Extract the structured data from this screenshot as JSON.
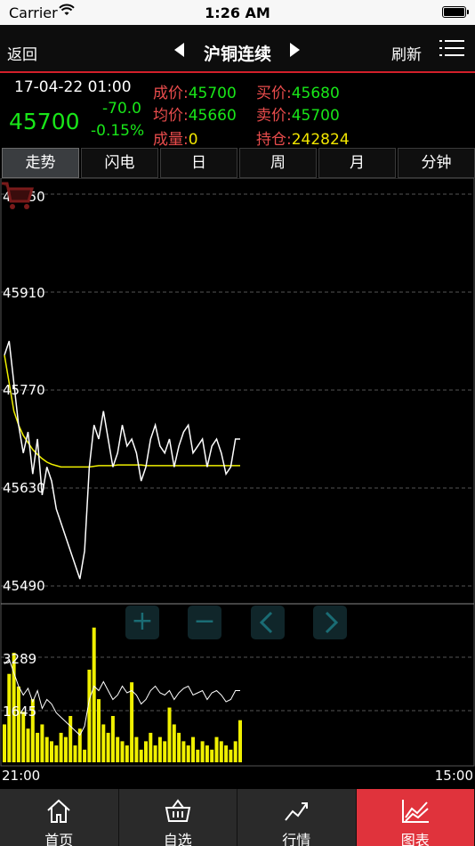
{
  "status": {
    "carrier": "Carrier",
    "time": "1:26 AM"
  },
  "nav": {
    "back": "返回",
    "title": "沪铜连续",
    "refresh": "刷新"
  },
  "quote": {
    "datetime": "17-04-22 01:00",
    "price": "45700",
    "change": "-70.0",
    "change_pct": "-0.15%",
    "fields": [
      {
        "label": "成价:",
        "value": "45700",
        "color": "green"
      },
      {
        "label": "均价:",
        "value": "45660",
        "color": "green"
      },
      {
        "label": "成量:",
        "value": "0",
        "color": "yellow"
      },
      {
        "label": "买价:",
        "value": "45680",
        "color": "green"
      },
      {
        "label": "卖价:",
        "value": "45700",
        "color": "green"
      },
      {
        "label": "持仓:",
        "value": "242824",
        "color": "yellow"
      }
    ]
  },
  "tabs": [
    "走势",
    "闪电",
    "日",
    "周",
    "月",
    "分钟"
  ],
  "active_tab": "走势",
  "chart_data": {
    "type": "line",
    "price_axis": {
      "ticks": [
        "46050",
        "45910",
        "45770",
        "45630",
        "45490"
      ],
      "ylim": [
        45490,
        46050
      ]
    },
    "volume_axis": {
      "ticks": [
        "3289",
        "1645"
      ]
    },
    "x_labels": [
      "21:00",
      "15:00"
    ],
    "series": [
      {
        "values": [
          45820,
          45840,
          45780,
          45720,
          45680,
          45710,
          45650,
          45700,
          45620,
          45660,
          45640,
          45600,
          45580,
          45560,
          45540,
          45520,
          45500,
          45540,
          45660,
          45720,
          45700,
          45740,
          45700,
          45660,
          45680,
          45720,
          45690,
          45700,
          45680,
          45640,
          45660,
          45700,
          45720,
          45690,
          45680,
          45700,
          45660,
          45690,
          45710,
          45720,
          45680,
          45690,
          45700,
          45660,
          45690,
          45700,
          45680,
          45650,
          45660,
          45700,
          45700
        ]
      },
      {
        "values": [
          45820,
          45780,
          45740,
          45720,
          45705,
          45695,
          45685,
          45678,
          45672,
          45667,
          45664,
          45662,
          45660,
          45660,
          45660,
          45660,
          45660,
          45660,
          45660,
          45661,
          45662,
          45662,
          45662,
          45662,
          45663,
          45663,
          45663,
          45663,
          45663,
          45663,
          45662,
          45662,
          45662,
          45662,
          45662,
          45662,
          45662,
          45662,
          45662,
          45662,
          45662,
          45662,
          45662,
          45662,
          45662,
          45662,
          45662,
          45662,
          45662,
          45662,
          45662
        ]
      }
    ],
    "volume": [
      900,
      2100,
      2600,
      1800,
      1200,
      800,
      1500,
      700,
      900,
      600,
      500,
      400,
      700,
      600,
      1100,
      400,
      800,
      300,
      2200,
      3200,
      1500,
      900,
      700,
      1100,
      600,
      500,
      400,
      1900,
      600,
      300,
      500,
      700,
      400,
      600,
      500,
      1300,
      900,
      700,
      500,
      400,
      600,
      300,
      500,
      400,
      300,
      600,
      500,
      400,
      300,
      500,
      1000
    ],
    "volume_colors": {
      "bar": "#f0f000",
      "line": "#ffffff"
    }
  },
  "controls": {
    "plus": "+",
    "minus": "−"
  },
  "tabbar": [
    {
      "label": "首页",
      "icon": "home-icon"
    },
    {
      "label": "自选",
      "icon": "basket-icon"
    },
    {
      "label": "行情",
      "icon": "trend-icon"
    },
    {
      "label": "图表",
      "icon": "chart-icon"
    }
  ],
  "colors": {
    "accent": "#e0333c",
    "up": "#19e619",
    "label": "#e94c4c",
    "highlight": "#f2e600"
  }
}
